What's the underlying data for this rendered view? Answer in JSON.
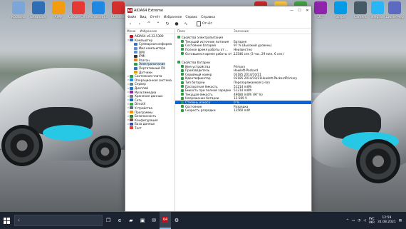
{
  "desktop_icons": [
    {
      "label": "Корзина",
      "icon": "recycle-bin-icon",
      "color": "#7aa7d8"
    },
    {
      "label": "Безопасн.",
      "icon": "security-icon",
      "color": "#2f6db5"
    },
    {
      "label": "AIMP",
      "icon": "aimp-icon",
      "color": "#f39c12"
    },
    {
      "label": "Google Chrome",
      "icon": "chrome-icon",
      "color": "#e53935"
    },
    {
      "label": "Microsoft Edge",
      "icon": "edge-icon",
      "color": "#1e88e5"
    },
    {
      "label": "CCleaner",
      "icon": "ccleaner-icon",
      "color": "#d32f2f"
    },
    {
      "label": "Opera",
      "icon": "opera-icon",
      "color": "#c62828"
    },
    {
      "label": "Total Commander",
      "icon": "total-commander-icon",
      "color": "#f6c343"
    },
    {
      "label": "DriverPack",
      "icon": "driverpack-icon",
      "color": "#43a047"
    },
    {
      "label": "DST",
      "icon": "dst-icon",
      "color": "#8e24aa"
    },
    {
      "label": "Skype",
      "icon": "skype-icon",
      "color": "#039be5"
    },
    {
      "label": "Camera",
      "icon": "camera-icon",
      "color": "#455a64"
    },
    {
      "label": "Telegram",
      "icon": "telegram-icon",
      "color": "#29b6f6"
    },
    {
      "label": "Диспетчер",
      "icon": "task-manager-icon",
      "color": "#5c6bc0"
    }
  ],
  "window": {
    "title": "AIDA64 Extreme",
    "app_icon_text": "64",
    "menu": [
      "Файл",
      "Вид",
      "Отчёт",
      "Избранное",
      "Сервис",
      "Справка"
    ],
    "report_label": "Отчёт",
    "left_tabs": [
      "Меню",
      "Избранное"
    ],
    "tree": [
      {
        "label": "AIDA64 v6.33.5300",
        "depth": 0,
        "exp": "",
        "color": "#c8101a"
      },
      {
        "label": "Компьютер",
        "depth": 0,
        "exp": "∨",
        "color": "#3b6fb6"
      },
      {
        "label": "Суммарная информа",
        "depth": 1,
        "exp": "",
        "color": "#3b6fb6"
      },
      {
        "label": "Имя компьютера",
        "depth": 1,
        "exp": "",
        "color": "#5c8fd6"
      },
      {
        "label": "DMI",
        "depth": 1,
        "exp": "",
        "color": "#5c8fd6"
      },
      {
        "label": "IPMI",
        "depth": 1,
        "exp": "",
        "color": "#333333"
      },
      {
        "label": "Разгон",
        "depth": 1,
        "exp": "",
        "color": "#e67e22"
      },
      {
        "label": "Электропитание",
        "depth": 1,
        "exp": "",
        "color": "#2e9e44",
        "selected": true
      },
      {
        "label": "Портативный ПК",
        "depth": 1,
        "exp": "",
        "color": "#3b6fb6"
      },
      {
        "label": "Датчики",
        "depth": 1,
        "exp": "",
        "color": "#e0a000"
      },
      {
        "label": "Системная плата",
        "depth": 0,
        "exp": ">",
        "color": "#2e9e44"
      },
      {
        "label": "Операционная система",
        "depth": 0,
        "exp": ">",
        "color": "#1e88e5"
      },
      {
        "label": "Сервер",
        "depth": 0,
        "exp": ">",
        "color": "#607d8b"
      },
      {
        "label": "Дисплей",
        "depth": 0,
        "exp": ">",
        "color": "#1976d2"
      },
      {
        "label": "Мультимедиа",
        "depth": 0,
        "exp": ">",
        "color": "#8e24aa"
      },
      {
        "label": "Хранение данных",
        "depth": 0,
        "exp": ">",
        "color": "#757575"
      },
      {
        "label": "Сеть",
        "depth": 0,
        "exp": ">",
        "color": "#1565c0"
      },
      {
        "label": "DirectX",
        "depth": 0,
        "exp": ">",
        "color": "#43a047"
      },
      {
        "label": "Устройства",
        "depth": 0,
        "exp": ">",
        "color": "#546e7a"
      },
      {
        "label": "Программы",
        "depth": 0,
        "exp": ">",
        "color": "#fb8c00"
      },
      {
        "label": "Безопасность",
        "depth": 0,
        "exp": ">",
        "color": "#2e7d32"
      },
      {
        "label": "Конфигурация",
        "depth": 0,
        "exp": ">",
        "color": "#6d4c41"
      },
      {
        "label": "База данных",
        "depth": 0,
        "exp": ">",
        "color": "#3949ab"
      },
      {
        "label": "Тест",
        "depth": 0,
        "exp": "",
        "color": "#e53935"
      }
    ],
    "columns": [
      "Поле",
      "Значение"
    ],
    "groups": [
      {
        "title": "Свойства электропитания",
        "color": "#2e9e44",
        "rows": [
          {
            "field": "Текущий источник питания",
            "value": "Батарея",
            "color": "#2e9e44"
          },
          {
            "field": "Состояние батарей",
            "value": "97 % (Высокий уровень)",
            "color": "#2e9e44"
          },
          {
            "field": "Полное время работы от ...",
            "value": "Неизвестно",
            "color": "#2e9e44"
          },
          {
            "field": "Оставшееся время работы от ...",
            "value": "12546 сек (3 час, 29 мин, 6 сек)",
            "color": "#2e9e44"
          }
        ]
      },
      {
        "title": "Свойства батареи",
        "color": "#2e9e44",
        "rows": [
          {
            "field": "Имя устройства",
            "value": "Primary",
            "color": "#2e9e44"
          },
          {
            "field": "Производитель",
            "value": "Hewlett-Packard",
            "color": "#2e9e44"
          },
          {
            "field": "Серийный номер",
            "value": "03185 2014/10/21",
            "color": "#2e9e44"
          },
          {
            "field": "Идентификатор",
            "value": "03185 2014/10/21Hewlett-PackardPrimary",
            "color": "#2e9e44"
          },
          {
            "field": "Тип батареи",
            "value": "Перезаряжаемая Li-Ion",
            "color": "#2e9e44"
          },
          {
            "field": "Паспортная ёмкость",
            "value": "51214 mWh",
            "color": "#2e9e44"
          },
          {
            "field": "Ёмкость при полной зарядке",
            "value": "51214 mWh",
            "color": "#2e9e44"
          },
          {
            "field": "Текущая ёмкость",
            "value": "49680 mWh  (97 %)",
            "color": "#2e9e44"
          },
          {
            "field": "Напряжение батареи",
            "value": "12.589 V",
            "color": "#2e9e44"
          },
          {
            "field": "Степень износа",
            "value": "0 %",
            "color": "#2e9e44",
            "selected": true
          },
          {
            "field": "Состояние",
            "value": "Разрядка",
            "color": "#2e9e44"
          },
          {
            "field": "Скорость разрядки",
            "value": "12560 mW",
            "color": "#2e9e44"
          }
        ]
      }
    ]
  },
  "taskbar": {
    "search_placeholder": "",
    "apps": [
      {
        "name": "task-view",
        "glyph": "❐"
      },
      {
        "name": "edge",
        "glyph": "e"
      },
      {
        "name": "file-explorer",
        "glyph": "▰"
      },
      {
        "name": "store",
        "glyph": "▣"
      },
      {
        "name": "mail",
        "glyph": "✉"
      },
      {
        "name": "aida64",
        "glyph": "64",
        "active": true
      },
      {
        "name": "settings",
        "glyph": "⚙"
      }
    ],
    "lang_top": "РУС",
    "lang_bottom": "UKR",
    "time": "12:59",
    "date": "31.08.2021"
  }
}
